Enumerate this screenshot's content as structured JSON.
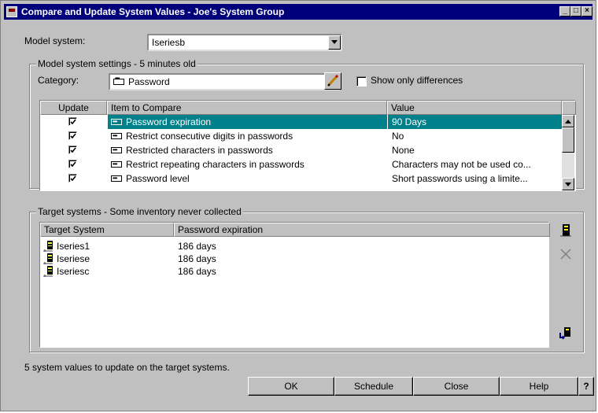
{
  "window": {
    "title": "Compare and Update System Values - Joe's System Group",
    "controls": [
      "minimize-icon",
      "maximize-icon",
      "close-icon"
    ]
  },
  "model": {
    "label": "Model system:",
    "value": "Iseriesb"
  },
  "settings_group": {
    "legend": "Model system settings - 5 minutes old",
    "category_label": "Category:",
    "category_value": "Password",
    "show_diff_label": "Show only differences",
    "show_diff_checked": false,
    "columns": [
      "Update",
      "Item to Compare",
      "Value"
    ],
    "rows": [
      {
        "update": true,
        "item": "Password expiration",
        "value": "90 Days",
        "selected": true
      },
      {
        "update": true,
        "item": "Restrict consecutive digits in passwords",
        "value": "No",
        "selected": false
      },
      {
        "update": true,
        "item": "Restricted characters in passwords",
        "value": "None",
        "selected": false
      },
      {
        "update": true,
        "item": "Restrict repeating characters in passwords",
        "value": "Characters may not be used co...",
        "selected": false
      },
      {
        "update": true,
        "item": "Password level",
        "value": "Short passwords using a limite...",
        "selected": false
      }
    ]
  },
  "targets_group": {
    "legend": "Target systems - Some inventory never collected",
    "columns": [
      "Target System",
      "Password expiration"
    ],
    "rows": [
      {
        "system": "Iseries1",
        "value": "186 days"
      },
      {
        "system": "Iseriese",
        "value": "186 days"
      },
      {
        "system": "Iseriesc",
        "value": "186 days"
      }
    ]
  },
  "status_text": "5 system values to update on the target systems.",
  "buttons": {
    "ok": "OK",
    "schedule": "Schedule",
    "close": "Close",
    "help": "Help",
    "whats_this": "?"
  }
}
